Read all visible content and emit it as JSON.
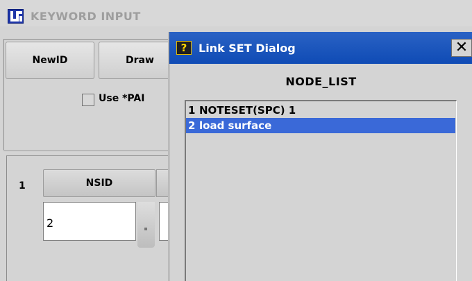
{
  "background_window": {
    "title": "KEYWORD INPUT",
    "buttons": {
      "newid": "NewID",
      "draw": "Draw"
    },
    "checkbox_label": "Use *PAI",
    "table": {
      "row_number": "1",
      "column_header": "NSID",
      "cell_value": "2"
    }
  },
  "dialog": {
    "title": "Link SET Dialog",
    "help_icon_glyph": "?",
    "close_glyph": "✕",
    "list_title": "NODE_LIST",
    "items": [
      {
        "index": "1",
        "label": "NOTESET(SPC) 1",
        "selected": false
      },
      {
        "index": "2",
        "label": "load surface",
        "selected": true
      }
    ]
  },
  "colors": {
    "dialog_titlebar": "#1a56bf",
    "selection": "#3a69d8",
    "window_bg": "#d4d4d4"
  }
}
